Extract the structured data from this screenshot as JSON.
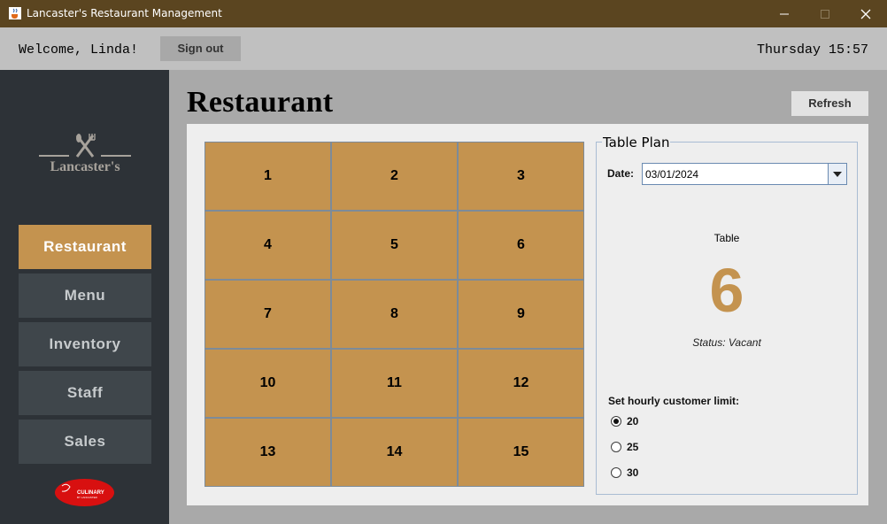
{
  "window": {
    "title": "Lancaster's Restaurant Management",
    "icon": "java-cup-icon"
  },
  "topbar": {
    "welcome": "Welcome, Linda!",
    "signout_label": "Sign out",
    "clock": "Thursday 15:57"
  },
  "sidebar": {
    "logo_text": "Lancaster's",
    "items": [
      {
        "label": "Restaurant",
        "active": true
      },
      {
        "label": "Menu",
        "active": false
      },
      {
        "label": "Inventory",
        "active": false
      },
      {
        "label": "Staff",
        "active": false
      },
      {
        "label": "Sales",
        "active": false
      }
    ],
    "badge_text": "CULINARY",
    "badge_subtext": "BY LANCASTER"
  },
  "main": {
    "heading": "Restaurant",
    "refresh_label": "Refresh",
    "tables": [
      "1",
      "2",
      "3",
      "4",
      "5",
      "6",
      "7",
      "8",
      "9",
      "10",
      "11",
      "12",
      "13",
      "14",
      "15"
    ],
    "plan": {
      "title": "Table Plan",
      "date_label": "Date:",
      "date_value": "03/01/2024",
      "table_label": "Table",
      "selected_table": "6",
      "status": "Status: Vacant",
      "limit_label": "Set hourly customer limit:",
      "limit_options": [
        "20",
        "25",
        "30"
      ],
      "limit_selected": "20"
    }
  },
  "colors": {
    "accent": "#c4934f",
    "sidebar": "#2d3237",
    "titlebar": "#5b4520"
  }
}
